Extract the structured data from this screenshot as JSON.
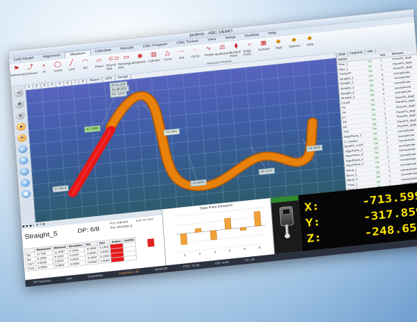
{
  "window": {
    "title": "pcdmis - ABC DEMO"
  },
  "menu_tabs": [
    "CAD Model",
    "Alignment",
    "Measure",
    "Calculate",
    "Results",
    "CNC Program",
    "CNC Toolset",
    "View",
    "Setup",
    "Desktop",
    "Help"
  ],
  "active_tab": "Measure",
  "ribbon_buttons": [
    "Reference",
    "Construct",
    "Pt",
    "Circle",
    "Line",
    "Arc",
    "Plane",
    "Round Slot",
    "Rectangular Slot",
    "Sphere",
    "Cylinder",
    "Cone",
    "Set",
    "Circle",
    "Profile",
    "Iqualization",
    "Surface Point",
    "Edge Point",
    "Surface"
  ],
  "ribbon_extras": {
    "tags": "Tags",
    "options": "Options",
    "help": "Help"
  },
  "ribbon_group_label": "Measure Feature",
  "view_tabs": [
    "1",
    "2",
    "3",
    "4",
    "5",
    "6",
    "7",
    "8",
    "Report",
    "DPS",
    "Design"
  ],
  "feature_list": {
    "tabs": [
      "Data",
      "Features",
      "Info"
    ],
    "headers": [
      "Name",
      "",
      "Info",
      "Remark"
    ],
    "rows": [
      {
        "name": "Plan_1",
        "st": "OK",
        "n": "1",
        "rem": "PlaneFit_dpgh"
      },
      {
        "name": "Plan_1",
        "st": "OK",
        "n": "1",
        "rem": "PlaneFit_dpgh"
      },
      {
        "name": "CentrePt",
        "st": "OK",
        "n": "1",
        "rem": "PlaneFit_dpgh"
      },
      {
        "name": "Straight_1",
        "st": "OK",
        "n": "6",
        "rem": "nonreplicate"
      },
      {
        "name": "Straight_2",
        "st": "OK",
        "n": "6",
        "rem": "nonreplicate"
      },
      {
        "name": "Straight_3",
        "st": "OK",
        "n": "6",
        "rem": "nonreplicate"
      },
      {
        "name": "Straight_4",
        "st": "OK",
        "n": "6",
        "rem": "nonreplicate"
      },
      {
        "name": "Straight_5",
        "st": "OK",
        "n": "6",
        "rem": "nonreplicate"
      },
      {
        "name": "CrLEF",
        "st": "OK",
        "n": "1",
        "rem": "PlaneFit_dpgh"
      },
      {
        "name": "P5",
        "st": "OK",
        "n": "1",
        "rem": "PlaneFit_dpgh"
      },
      {
        "name": "P6",
        "st": "OK",
        "n": "1",
        "rem": "PlaneFit_dpgh"
      },
      {
        "name": "P7",
        "st": "OK",
        "n": "1",
        "rem": "PlaneFit_dpgh"
      },
      {
        "name": "P8",
        "st": "OK",
        "n": "1",
        "rem": "PlaneFit_dpgh"
      },
      {
        "name": "P9",
        "st": "OK",
        "n": "1",
        "rem": "PlaneFit_dpgh"
      },
      {
        "name": "P10",
        "st": "OK",
        "n": "1",
        "rem": "PlaneFit_dpgh"
      },
      {
        "name": "AlignPlane_1",
        "st": "OK",
        "n": "1",
        "rem": "nonreplicate"
      },
      {
        "name": "P_rotated",
        "st": "OK",
        "n": "1",
        "rem": "nonreplicate"
      },
      {
        "name": "BestFit_1cord",
        "st": "OK",
        "n": "1",
        "rem": "nonreplicate"
      },
      {
        "name": "AlignPlane_2",
        "st": "OK",
        "n": "1",
        "rem": "nonreplicate"
      },
      {
        "name": "AlignPlane_3",
        "st": "OK",
        "n": "1",
        "rem": "nonreplicate"
      },
      {
        "name": "AlignPlane_4",
        "st": "OK",
        "n": "1",
        "rem": "nonreplicate"
      },
      {
        "name": "AlignPlane_5",
        "st": "OK",
        "n": "1",
        "rem": "nonreplicate"
      },
      {
        "name": "Bend_1",
        "st": "OK",
        "n": "1",
        "rem": "nonreplicate"
      },
      {
        "name": "Bend_2",
        "st": "OK",
        "n": "1",
        "rem": "nonreplicate"
      },
      {
        "name": "Bend_3",
        "st": "OK",
        "n": "1",
        "rem": "nonreplicate"
      },
      {
        "name": "Twist_1",
        "st": "OK",
        "n": "1",
        "rem": "nonreplicate"
      },
      {
        "name": "Twist_2",
        "st": "OK",
        "n": "1",
        "rem": "nonreplicate"
      },
      {
        "name": "Twist_3",
        "st": "OK",
        "n": "1",
        "rem": "nonreplicate"
      },
      {
        "name": "Dist_1",
        "st": "OK",
        "n": "1",
        "rem": "nonreplicate"
      },
      {
        "name": "Dist_2",
        "st": "OK",
        "n": "1",
        "rem": "nonreplicate"
      },
      {
        "name": "Dist_3",
        "st": "OK",
        "n": "1",
        "rem": "nonreplicate"
      }
    ]
  },
  "view_labels": [
    {
      "text": "Pt 41.222"
    },
    {
      "text": "Py 80.502"
    },
    {
      "text": "Pz -12.6"
    },
    {
      "text": "47.1000"
    },
    {
      "text": "53.0901"
    },
    {
      "text": "27.4513"
    },
    {
      "text": "18.4090"
    },
    {
      "text": "63.2210"
    },
    {
      "text": "53.9420"
    }
  ],
  "feature_panel": {
    "name": "Straight_5",
    "dp_label": "DP: 6/8",
    "meta_a": "Pol: relevant",
    "meta_b": "Pol: WHOB6 Q",
    "meta_c": "Cor: 6 / Ovl",
    "table_headers": [
      "",
      "Measured",
      "Nominal",
      "Deviation",
      "Tol-",
      "Tol+",
      "Action",
      "OutTol"
    ],
    "table_rows": [
      [
        "Da",
        "11.789",
        "11.4507",
        "0.1629",
        "-0.0000",
        "0.1000",
        "red",
        ""
      ],
      [
        "Da",
        "0.1029",
        "0.1029",
        "0.1029",
        "-0.0000",
        "0.0000",
        "red",
        ""
      ],
      [
        "CorY",
        "0.0290",
        "0.0257",
        "0.0033",
        "-0.0000",
        "0.1000",
        "red",
        ""
      ],
      [
        "CorZ",
        "0.0065",
        "0.0062",
        "0.0000",
        "-0.0000",
        "0.0000",
        "red",
        ""
      ]
    ]
  },
  "deviation_chart_title": "Data Point Deviation",
  "chart_data": {
    "type": "bar",
    "title": "Data Point Deviation",
    "categories": [
      "1",
      "2",
      "3",
      "4",
      "5",
      "6"
    ],
    "values": [
      -0.6,
      0.2,
      -0.5,
      0.6,
      -0.15,
      0.8
    ],
    "ylim": [
      -1,
      1
    ],
    "grid": true
  },
  "dro": {
    "x_label": "X:",
    "x_value": "-713.599",
    "y_label": "Y:",
    "y_value": "-317.859",
    "z_label": "Z:",
    "z_value": "-248.658"
  },
  "status_bar": [
    "44 Features",
    "mm",
    "Coachine1",
    "Coachine1 10",
    "00:00:00",
    "FPS: 70.48",
    "DR: none",
    "TC: off"
  ],
  "colors": {
    "tube": "#e8820c",
    "red_segment": "#e81818",
    "dro_text": "#ffe400",
    "ok_green": "#2a8a2a"
  }
}
